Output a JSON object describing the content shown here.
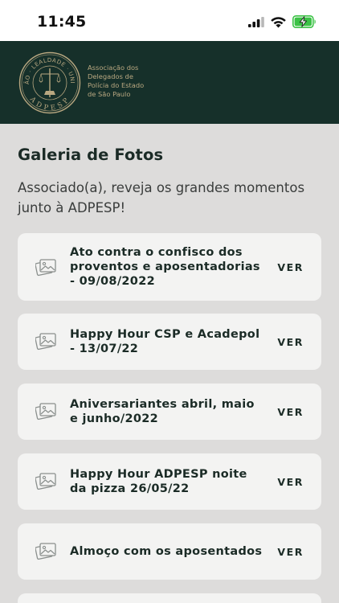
{
  "status_bar": {
    "time": "11:45"
  },
  "header": {
    "seal_text_top": "AÇÃO · LEALDADE · UNIÃO",
    "seal_text_bottom": "ADPESP",
    "org_name": "Associação dos\nDelegados de\nPolícia do Estado\nde São Paulo"
  },
  "page": {
    "title": "Galeria de Fotos",
    "intro": "Associado(a), reveja os grandes momentos junto à ADPESP!"
  },
  "gallery": [
    {
      "title": "Ato contra o confisco dos proventos e aposentadorias - 09/08/2022",
      "action": "VER"
    },
    {
      "title": "Happy Hour CSP e Acadepol - 13/07/22",
      "action": "VER"
    },
    {
      "title": "Aniversariantes abril, maio e junho/2022",
      "action": "VER"
    },
    {
      "title": "Happy Hour ADPESP noite da pizza 26/05/22",
      "action": "VER"
    },
    {
      "title": "Almoço com os aposentados",
      "action": "VER"
    }
  ],
  "colors": {
    "header_bg": "#16302a",
    "accent_gold": "#b9a881",
    "page_bg": "#dddcdb",
    "card_bg": "#f3f3f2"
  },
  "icons": [
    "cellular-signal-icon",
    "wifi-icon",
    "battery-charging-icon",
    "photo-gallery-icon"
  ]
}
